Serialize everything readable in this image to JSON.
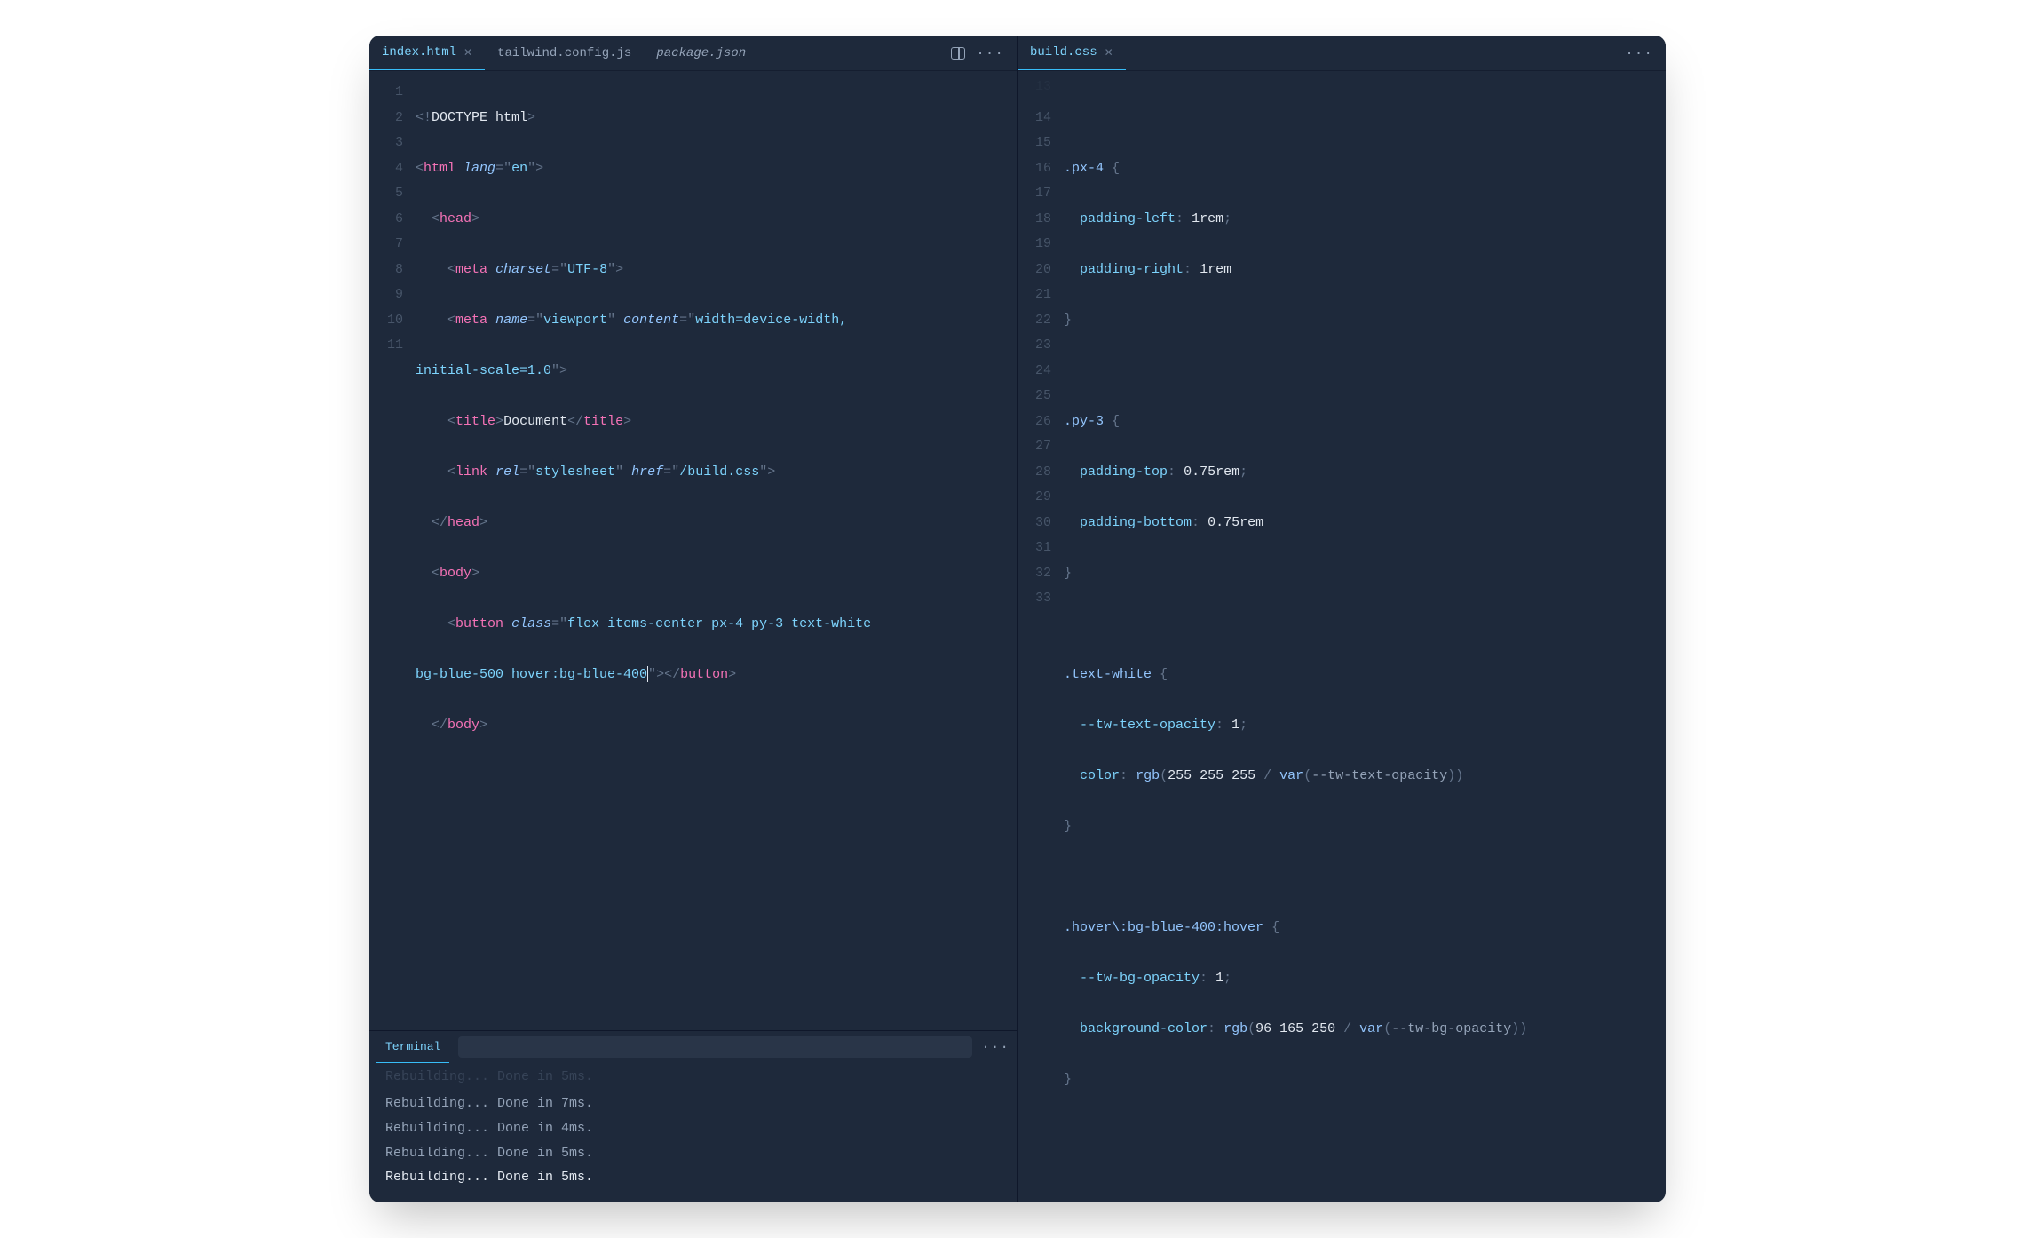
{
  "left": {
    "tabs": [
      {
        "label": "index.html",
        "active": true,
        "closable": true,
        "italic": false
      },
      {
        "label": "tailwind.config.js",
        "active": false,
        "closable": false,
        "italic": false
      },
      {
        "label": "package.json",
        "active": false,
        "closable": false,
        "italic": true
      }
    ],
    "lines": [
      1,
      2,
      3,
      4,
      5,
      6,
      7,
      8,
      9,
      10,
      11
    ],
    "code": {
      "l1": {
        "doctype": "DOCTYPE html"
      },
      "l2": {
        "tag": "html",
        "attr": "lang",
        "val": "en"
      },
      "l3": {
        "tag": "head"
      },
      "l4": {
        "tag": "meta",
        "attr": "charset",
        "val": "UTF-8"
      },
      "l5": {
        "tag": "meta",
        "attr1": "name",
        "val1": "viewport",
        "attr2": "content",
        "val2": "width=device-width, ",
        "wrap": "initial-scale=1.0"
      },
      "l6": {
        "tag": "title",
        "text": "Document"
      },
      "l7": {
        "tag": "link",
        "attr1": "rel",
        "val1": "stylesheet",
        "attr2": "href",
        "val2": "/build.css"
      },
      "l8": {
        "tag": "head"
      },
      "l9": {
        "tag": "body"
      },
      "l10": {
        "tag": "button",
        "attr": "class",
        "val": "flex items-center px-4 py-3 text-white ",
        "wrap": "bg-blue-500 hover:bg-blue-400"
      },
      "l11": {
        "tag": "body"
      }
    }
  },
  "right": {
    "tabs": [
      {
        "label": "build.css",
        "active": true,
        "closable": true
      }
    ],
    "startLine": 13,
    "lines": [
      13,
      14,
      15,
      16,
      17,
      18,
      19,
      20,
      21,
      22,
      23,
      24,
      25,
      26,
      27,
      28,
      29,
      30,
      31,
      32,
      33
    ],
    "css": {
      "r14": {
        "sel": ".px-4"
      },
      "r15": {
        "prop": "padding-left",
        "val": "1rem",
        "semi": ";"
      },
      "r16": {
        "prop": "padding-right",
        "val": "1rem",
        "semi": ""
      },
      "r19": {
        "sel": ".py-3"
      },
      "r20": {
        "prop": "padding-top",
        "val": "0.75rem",
        "semi": ";"
      },
      "r21": {
        "prop": "padding-bottom",
        "val": "0.75rem",
        "semi": ""
      },
      "r24": {
        "sel": ".text-white"
      },
      "r25": {
        "prop": "--tw-text-opacity",
        "val": "1",
        "semi": ";"
      },
      "r26": {
        "prop": "color",
        "func": "rgb",
        "args": "255 255 255",
        "varfn": "var",
        "varname": "--tw-text-opacity"
      },
      "r29": {
        "sel": ".hover\\:bg-blue-400",
        "pseudo": ":hover"
      },
      "r30": {
        "prop": "--tw-bg-opacity",
        "val": "1",
        "semi": ";"
      },
      "r31": {
        "prop": "background-color",
        "func": "rgb",
        "args": "96 165 250",
        "varfn": "var",
        "varname": "--tw-bg-opacity"
      }
    }
  },
  "terminal": {
    "tab": "Terminal",
    "lines": [
      {
        "text": "Rebuilding... Done in 5ms.",
        "style": "fade-cut"
      },
      {
        "text": "Rebuilding... Done in 7ms.",
        "style": "normal"
      },
      {
        "text": "Rebuilding... Done in 4ms.",
        "style": "normal"
      },
      {
        "text": "Rebuilding... Done in 5ms.",
        "style": "normal"
      },
      {
        "text": "Rebuilding... Done in 5ms.",
        "style": "bright"
      }
    ]
  }
}
